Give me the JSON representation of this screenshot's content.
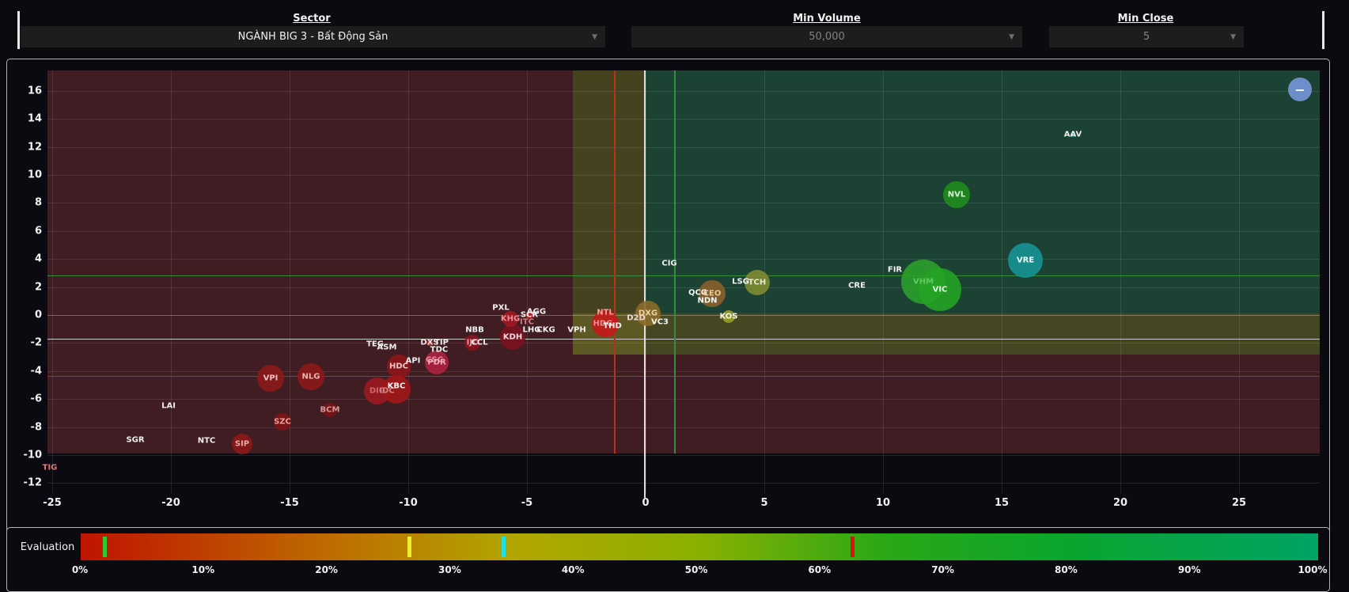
{
  "filters": {
    "sector": {
      "label": "Sector",
      "value": "NGÀNH BIG 3 - Bất Động Sản"
    },
    "min_volume": {
      "label": "Min Volume",
      "value": "50,000"
    },
    "min_close": {
      "label": "Min Close",
      "value": "5"
    }
  },
  "controls": {
    "zoom_out_label": "−"
  },
  "chart_data": {
    "type": "scatter",
    "title": "",
    "xlabel": "",
    "ylabel": "",
    "x_ticks": [
      -25,
      -20,
      -15,
      -10,
      -5,
      0,
      5,
      10,
      15,
      20,
      25
    ],
    "y_ticks": [
      16,
      14,
      12,
      10,
      8,
      6,
      4,
      2,
      0,
      -2,
      -4,
      -6,
      -8,
      -10,
      -12
    ],
    "x_range": [
      -25.2,
      28.4
    ],
    "y_range": [
      -12.7,
      17.5
    ],
    "grid": true,
    "regions": [
      {
        "name": "loss-zone-left",
        "x0": -25.2,
        "x1": -3.07,
        "y0": -9.9,
        "y1": 17.5,
        "color": "#3f1d22"
      },
      {
        "name": "loss-zone-bottom",
        "x0": -3.07,
        "x1": 28.4,
        "y0": -9.9,
        "y1": -2.85,
        "color": "#3f1d22"
      },
      {
        "name": "gain-zone",
        "x0": -0.05,
        "x1": 28.4,
        "y0": 0.1,
        "y1": 17.5,
        "color": "#1c4233"
      },
      {
        "name": "neutral-band-vertical",
        "x0": -3.07,
        "x1": -0.05,
        "y0": 0.1,
        "y1": 17.5,
        "color": "#45421f"
      },
      {
        "name": "neutral-band-cross",
        "x0": -3.07,
        "x1": -0.05,
        "y0": -2.85,
        "y1": 0.1,
        "color": "#5d5824"
      },
      {
        "name": "neutral-band-right",
        "x0": -0.05,
        "x1": 28.4,
        "y0": -2.85,
        "y1": 0.1,
        "color": "#454723"
      }
    ],
    "reference_lines": [
      {
        "name": "h-green",
        "orient": "h",
        "value": 2.8,
        "color": "#3c8a3c",
        "w": 1
      },
      {
        "name": "h-white",
        "orient": "h",
        "value": -1.7,
        "color": "#c9c9c9",
        "w": 1
      },
      {
        "name": "h-red",
        "orient": "h",
        "value": -4.35,
        "color": "#c32322",
        "w": 1
      },
      {
        "name": "v-red",
        "orient": "v",
        "value": -1.33,
        "color": "#b5321e",
        "w": 2
      },
      {
        "name": "v-zero",
        "orient": "v",
        "value": -0.07,
        "color": "#dedede",
        "w": 2,
        "extend": true
      },
      {
        "name": "v-green",
        "orient": "v",
        "value": 1.2,
        "color": "#2f9140",
        "w": 2
      }
    ],
    "points": [
      {
        "t": "TIG",
        "x": -25.1,
        "y": -10.9,
        "r": 0,
        "bc": null,
        "tc": "#e07878"
      },
      {
        "t": "SGR",
        "x": -21.5,
        "y": -8.9,
        "r": 0,
        "bc": null,
        "tc": "#f0f0f0"
      },
      {
        "t": "NTC",
        "x": -18.5,
        "y": -9.0,
        "r": 0,
        "bc": null,
        "tc": "#f0f0f0"
      },
      {
        "t": "SIP",
        "x": -17.0,
        "y": -9.2,
        "r": 13,
        "bc": "#8c1a1a",
        "tc": "#e8a8a8"
      },
      {
        "t": "LAI",
        "x": -20.1,
        "y": -6.5,
        "r": 0,
        "bc": null,
        "tc": "#f0f0f0"
      },
      {
        "t": "SZC",
        "x": -15.3,
        "y": -7.6,
        "r": 11,
        "bc": "#7e1515",
        "tc": "#e8a0a0"
      },
      {
        "t": "BCM",
        "x": -13.3,
        "y": -6.8,
        "r": 9,
        "bc": "#751518",
        "tc": "#d89898"
      },
      {
        "t": "VPI",
        "x": -15.8,
        "y": -4.5,
        "r": 17,
        "bc": "#8c1a1a",
        "tc": "#eec2c2"
      },
      {
        "t": "NLG",
        "x": -14.1,
        "y": -4.4,
        "r": 17,
        "bc": "#8c1a1a",
        "tc": "#e8b4b4"
      },
      {
        "t": "TEG",
        "x": -11.4,
        "y": -2.1,
        "r": 0,
        "bc": null,
        "tc": "#f0f0f0"
      },
      {
        "t": "ASM",
        "x": -10.9,
        "y": -2.3,
        "r": 0,
        "bc": null,
        "tc": "#f0f0f0"
      },
      {
        "t": "DXS",
        "x": -9.1,
        "y": -2.0,
        "r": 4,
        "bc": "#c03030",
        "tc": "#f0e0e0"
      },
      {
        "t": "TIP",
        "x": -8.6,
        "y": -2.0,
        "r": 0,
        "bc": null,
        "tc": "#f0f0f0"
      },
      {
        "t": "TDC",
        "x": -8.7,
        "y": -2.5,
        "r": 0,
        "bc": null,
        "tc": "#f0f0f0"
      },
      {
        "t": "CSC",
        "x": -8.9,
        "y": -3.2,
        "r": 0,
        "bc": null,
        "tc": "#e08e9a"
      },
      {
        "t": "PDR",
        "x": -8.8,
        "y": -3.4,
        "r": 15,
        "bc": "#ae2240",
        "tc": "#f4aab8"
      },
      {
        "t": "HDC",
        "x": -10.4,
        "y": -3.7,
        "r": 15,
        "bc": "#8c1518",
        "tc": "#eec6c6"
      },
      {
        "t": "API",
        "x": -9.8,
        "y": -3.3,
        "r": 0,
        "bc": null,
        "tc": "#f0f0f0"
      },
      {
        "t": "DIG",
        "x": -11.3,
        "y": -5.4,
        "r": 17,
        "bc": "#9c1a20",
        "tc": "#cf6a6a"
      },
      {
        "t": "IDC",
        "x": -10.9,
        "y": -5.4,
        "r": 0,
        "bc": null,
        "tc": "#d08585"
      },
      {
        "t": "KBC",
        "x": -10.5,
        "y": -5.3,
        "r": 18,
        "bc": "#a01818",
        "tc": "#f5f5f5",
        "dy": -4
      },
      {
        "t": "NBB",
        "x": -7.2,
        "y": -1.1,
        "r": 0,
        "bc": null,
        "tc": "#f0f0f0"
      },
      {
        "t": "IJC",
        "x": -7.3,
        "y": -2.0,
        "r": 10,
        "bc": "#8c1520",
        "tc": "#e39aa2"
      },
      {
        "t": "CCL",
        "x": -7.0,
        "y": -2.0,
        "r": 0,
        "bc": null,
        "tc": "#f0f0f0"
      },
      {
        "t": "KDH",
        "x": -5.6,
        "y": -1.6,
        "r": 16,
        "bc": "#7a1220",
        "tc": "#f0d8dc"
      },
      {
        "t": "LHG",
        "x": -4.8,
        "y": -1.1,
        "r": 0,
        "bc": null,
        "tc": "#f0f0f0"
      },
      {
        "t": "CKG",
        "x": -4.2,
        "y": -1.1,
        "r": 0,
        "bc": null,
        "tc": "#f0f0f0"
      },
      {
        "t": "PXL",
        "x": -6.1,
        "y": 0.5,
        "r": 0,
        "bc": null,
        "tc": "#f0f0f0"
      },
      {
        "t": "KHG",
        "x": -5.7,
        "y": -0.3,
        "r": 10,
        "bc": "#a01825",
        "tc": "#ef8f98"
      },
      {
        "t": "SCR",
        "x": -4.9,
        "y": 0.0,
        "r": 5,
        "bc": "#c02020",
        "tc": "#f0f0f0"
      },
      {
        "t": "ITC",
        "x": -5.0,
        "y": -0.5,
        "r": 0,
        "bc": null,
        "tc": "#d08080"
      },
      {
        "t": "AGG",
        "x": -4.6,
        "y": 0.2,
        "r": 0,
        "bc": null,
        "tc": "#f0f0f0"
      },
      {
        "t": "VPH",
        "x": -2.9,
        "y": -1.1,
        "r": 0,
        "bc": null,
        "tc": "#f0f0f0"
      },
      {
        "t": "NTL",
        "x": -1.7,
        "y": -0.6,
        "r": 17,
        "bc": "#c41a1a",
        "tc": "#ff9a9a",
        "dy": -14
      },
      {
        "t": "HDG",
        "x": -1.8,
        "y": -0.6,
        "r": 0,
        "bc": null,
        "tc": "#e09090"
      },
      {
        "t": "THD",
        "x": -1.4,
        "y": -0.8,
        "r": 0,
        "bc": null,
        "tc": "#f5f5f5"
      },
      {
        "t": "D2D",
        "x": -0.4,
        "y": -0.2,
        "r": 0,
        "bc": null,
        "tc": "#f0d8d8"
      },
      {
        "t": "DXG",
        "x": 0.1,
        "y": 0.1,
        "r": 16,
        "bc": "#8a6b2a",
        "tc": "#ecd2a2"
      },
      {
        "t": "VC3",
        "x": 0.6,
        "y": -0.5,
        "r": 0,
        "bc": null,
        "tc": "#f5f5f5"
      },
      {
        "t": "QCG",
        "x": 2.2,
        "y": 1.6,
        "r": 0,
        "bc": null,
        "tc": "#f5f5f5"
      },
      {
        "t": "CEO",
        "x": 2.8,
        "y": 1.5,
        "r": 17,
        "bc": "#8a5f2b",
        "tc": "#eccb96"
      },
      {
        "t": "NDN",
        "x": 2.6,
        "y": 1.0,
        "r": 0,
        "bc": null,
        "tc": "#f5f5f5"
      },
      {
        "t": "KOS",
        "x": 3.5,
        "y": -0.1,
        "r": 8,
        "bc": "#95a022",
        "tc": "#f5f5f5"
      },
      {
        "t": "LSG",
        "x": 4.0,
        "y": 2.4,
        "r": 0,
        "bc": null,
        "tc": "#f5f5f5"
      },
      {
        "t": "TCH",
        "x": 4.7,
        "y": 2.3,
        "r": 16,
        "bc": "#7f8c31",
        "tc": "#e6ead2"
      },
      {
        "t": "CIG",
        "x": 1.0,
        "y": 3.7,
        "r": 0,
        "bc": null,
        "tc": "#f0f0f0"
      },
      {
        "t": "CRE",
        "x": 8.9,
        "y": 2.1,
        "r": 0,
        "bc": null,
        "tc": "#f0f0f0"
      },
      {
        "t": "FIR",
        "x": 10.5,
        "y": 3.2,
        "r": 0,
        "bc": null,
        "tc": "#f0f0f0"
      },
      {
        "t": "VHM",
        "x": 11.7,
        "y": 2.4,
        "r": 28,
        "bc": "#2aa02a",
        "tc": "#62c862"
      },
      {
        "t": "VIC",
        "x": 12.4,
        "y": 1.8,
        "r": 27,
        "bc": "#22a322",
        "tc": "#f0fff0"
      },
      {
        "t": "VRE",
        "x": 16.0,
        "y": 3.9,
        "r": 22,
        "bc": "#169494",
        "tc": "#f5ffff"
      },
      {
        "t": "NVL",
        "x": 13.1,
        "y": 8.6,
        "r": 17,
        "bc": "#1e8c1e",
        "tc": "#d8f0d8"
      },
      {
        "t": "AAV",
        "x": 18.0,
        "y": 12.9,
        "r": 3,
        "bc": "#18a0a0",
        "tc": "#f0f0f0"
      }
    ]
  },
  "evaluation": {
    "label": "Evaluation",
    "axis_labels": [
      "0%",
      "10%",
      "20%",
      "30%",
      "40%",
      "50%",
      "60%",
      "70%",
      "80%",
      "90%",
      "100%"
    ],
    "gradient_stops": [
      {
        "pct": 0,
        "color": "#c01300"
      },
      {
        "pct": 20,
        "color": "#bd6c00"
      },
      {
        "pct": 35,
        "color": "#b2a600"
      },
      {
        "pct": 50,
        "color": "#8ab000"
      },
      {
        "pct": 65,
        "color": "#2aa816"
      },
      {
        "pct": 80,
        "color": "#0aa52e"
      },
      {
        "pct": 100,
        "color": "#00a464"
      }
    ],
    "markers": [
      {
        "pct": 1.8,
        "color": "#2ecc2e"
      },
      {
        "pct": 26.4,
        "color": "#f0f020"
      },
      {
        "pct": 34.0,
        "color": "#20e0e0"
      },
      {
        "pct": 62.2,
        "color": "#e01010"
      }
    ]
  }
}
